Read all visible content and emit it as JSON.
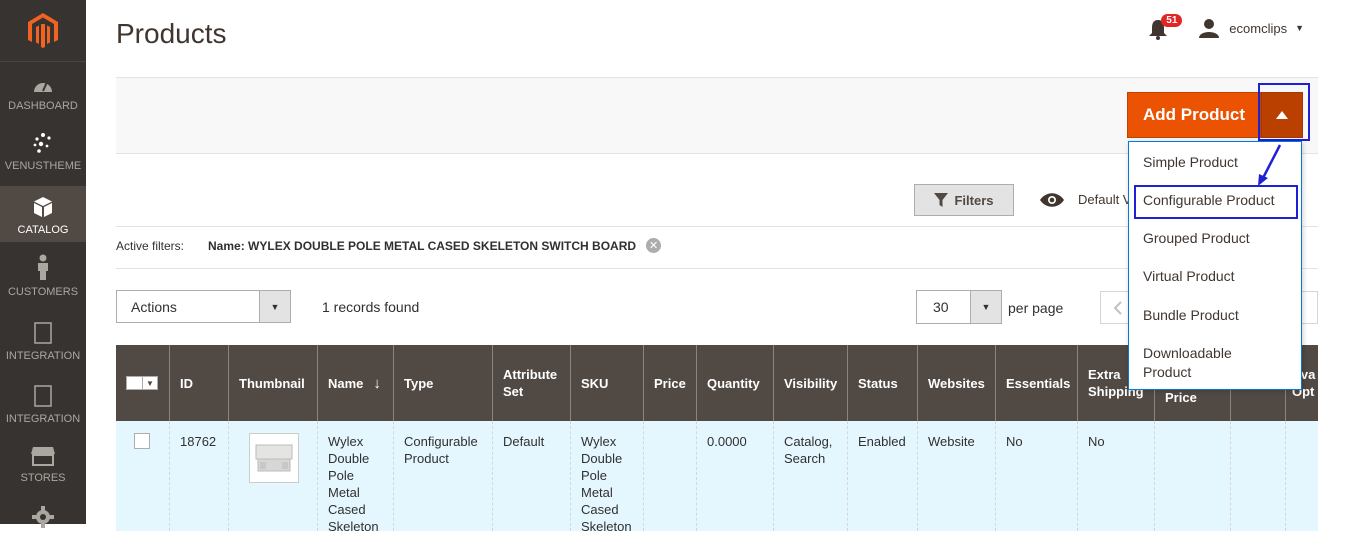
{
  "sidebar": {
    "items": [
      {
        "label": "DASHBOARD",
        "icon": "dashboard-icon"
      },
      {
        "label": "VENUSTHEME",
        "icon": "venustheme-icon"
      },
      {
        "label": "CATALOG",
        "icon": "catalog-icon"
      },
      {
        "label": "CUSTOMERS",
        "icon": "customers-icon"
      },
      {
        "label": "INTEGRATION",
        "icon": "integration-icon"
      },
      {
        "label": "INTEGRATION",
        "icon": "integration-icon"
      },
      {
        "label": "STORES",
        "icon": "stores-icon"
      }
    ]
  },
  "header": {
    "title": "Products",
    "notifications": "51",
    "user": "ecomclips"
  },
  "page_actions": {
    "add_product": "Add Product",
    "dropdown": [
      "Simple Product",
      "Configurable Product",
      "Grouped Product",
      "Virtual Product",
      "Bundle Product",
      "Downloadable Product"
    ]
  },
  "toolbar": {
    "filters": "Filters",
    "view": "Default V",
    "active_filters_label": "Active filters:",
    "active_filter_value": "Name: WYLEX DOUBLE POLE METAL CASED SKELETON SWITCH BOARD",
    "actions": "Actions",
    "records": "1 records found",
    "per_page_value": "30",
    "per_page_label": "per page"
  },
  "grid": {
    "columns": [
      "ID",
      "Thumbnail",
      "Name",
      "Type",
      "Attribute Set",
      "SKU",
      "Price",
      "Quantity",
      "Visibility",
      "Status",
      "Websites",
      "Essentials",
      "Extra Shipping",
      "Price",
      "",
      "Ava Opt"
    ],
    "sort_indicator": "↓",
    "row": {
      "id": "18762",
      "name": "Wylex Double Pole Metal Cased Skeleton",
      "type": "Configurable Product",
      "attribute_set": "Default",
      "sku": "Wylex Double Pole Metal Cased Skeleton",
      "price": "",
      "quantity": "0.0000",
      "visibility": "Catalog, Search",
      "status": "Enabled",
      "websites": "Website",
      "essentials": "No",
      "extra_shipping": "No"
    }
  },
  "colors": {
    "accent": "#eb5202",
    "sidebar": "#373330",
    "grid_header": "#514943",
    "highlight": "#1f1fd6"
  }
}
